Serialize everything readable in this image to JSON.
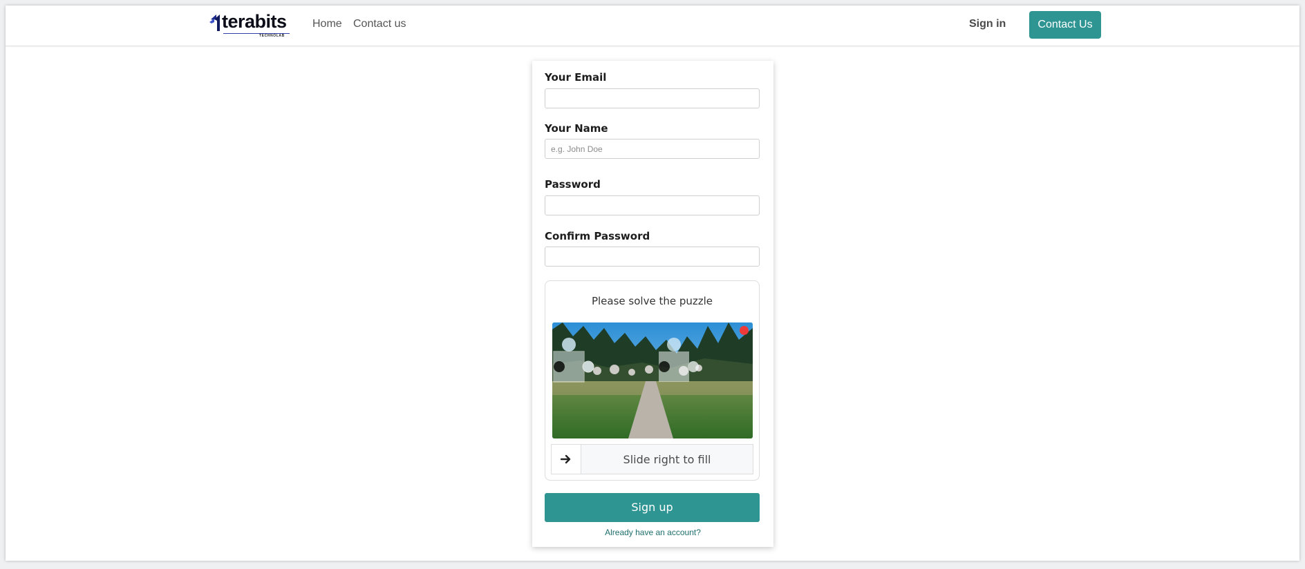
{
  "header": {
    "logo_text": "terabits",
    "logo_subtext": "TECHNOLAB",
    "nav": [
      {
        "label": "Home"
      },
      {
        "label": "Contact us"
      }
    ],
    "sign_in_label": "Sign in",
    "contact_button_label": "Contact Us"
  },
  "form": {
    "email": {
      "label": "Your Email",
      "value": "",
      "placeholder": ""
    },
    "name": {
      "label": "Your Name",
      "value": "",
      "placeholder": "e.g. John Doe"
    },
    "password": {
      "label": "Password",
      "value": "",
      "placeholder": ""
    },
    "confirm_password": {
      "label": "Confirm Password",
      "value": "",
      "placeholder": ""
    },
    "captcha": {
      "title": "Please solve the puzzle",
      "slider_text": "Slide right to fill",
      "handle_icon": "arrow-right-icon",
      "close_icon": "red-dot-icon"
    },
    "submit_label": "Sign up",
    "signin_link_label": "Already have an account?"
  },
  "colors": {
    "brand_teal": "#2f9593",
    "logo_blue": "#2e3fa8"
  }
}
